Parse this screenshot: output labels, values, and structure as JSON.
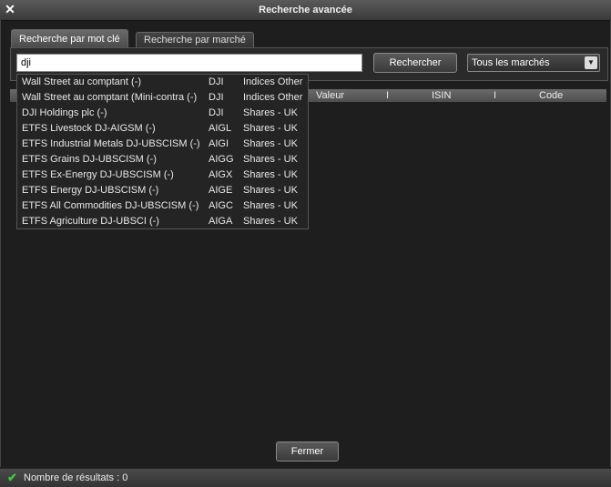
{
  "window": {
    "title": "Recherche avancée"
  },
  "tabs": [
    {
      "label": "Recherche par mot clé"
    },
    {
      "label": "Recherche par marché"
    }
  ],
  "search": {
    "value": "dji",
    "button_label": "Rechercher"
  },
  "market_select": {
    "selected": "Tous les marchés"
  },
  "table": {
    "columns": [
      "Valeur",
      "I",
      "ISIN",
      "I",
      "Code"
    ]
  },
  "suggestions": [
    {
      "name": "Wall Street au comptant (-)",
      "code": "DJI",
      "type": "Indices Other"
    },
    {
      "name": "Wall Street au comptant (Mini-contra (-)",
      "code": "DJI",
      "type": "Indices Other"
    },
    {
      "name": "DJI Holdings plc (-)",
      "code": "DJI",
      "type": "Shares - UK"
    },
    {
      "name": "ETFS Livestock DJ-AIGSM (-)",
      "code": "AIGL",
      "type": "Shares - UK"
    },
    {
      "name": "ETFS Industrial Metals DJ-UBSCISM (-)",
      "code": "AIGI",
      "type": "Shares - UK"
    },
    {
      "name": "ETFS Grains DJ-UBSCISM (-)",
      "code": "AIGG",
      "type": "Shares - UK"
    },
    {
      "name": "ETFS Ex-Energy DJ-UBSCISM (-)",
      "code": "AIGX",
      "type": "Shares - UK"
    },
    {
      "name": "ETFS Energy DJ-UBSCISM (-)",
      "code": "AIGE",
      "type": "Shares - UK"
    },
    {
      "name": "ETFS All Commodities DJ-UBSCISM (-)",
      "code": "AIGC",
      "type": "Shares - UK"
    },
    {
      "name": "ETFS Agriculture DJ-UBSCI (-)",
      "code": "AIGA",
      "type": "Shares - UK"
    }
  ],
  "footer": {
    "close_label": "Fermer"
  },
  "status": {
    "text": "Nombre de résultats : 0",
    "icon": "check-icon",
    "icon_color": "#3dcc3d"
  }
}
